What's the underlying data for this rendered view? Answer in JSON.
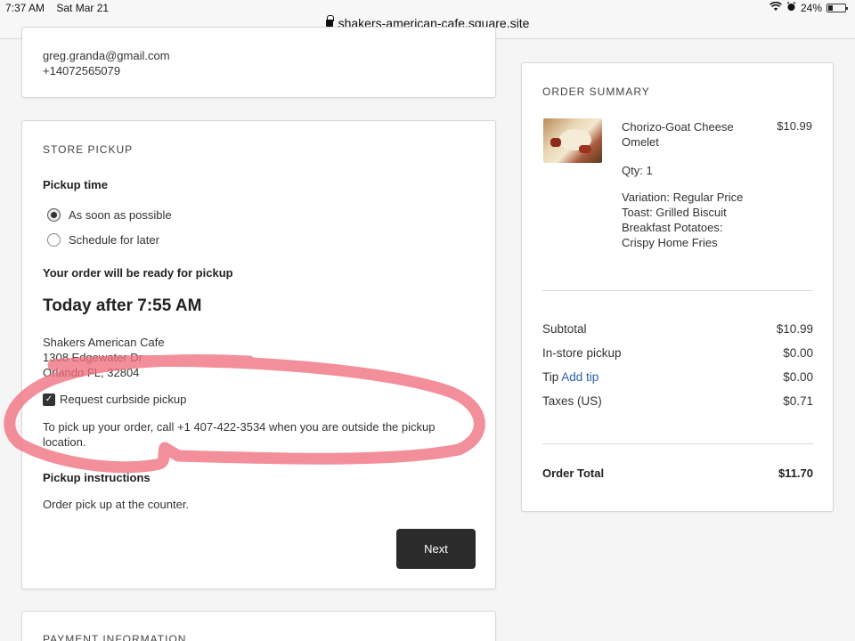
{
  "status": {
    "time": "7:37 AM",
    "date": "Sat Mar 21",
    "battery": "24%",
    "battery_level": 0.24
  },
  "browser": {
    "url": "shakers-american-cafe.square.site"
  },
  "contact": {
    "email": "greg.granda@gmail.com",
    "phone": "+14072565079"
  },
  "pickup": {
    "section_title": "STORE PICKUP",
    "pickup_time_label": "Pickup time",
    "options": [
      {
        "label": "As soon as possible",
        "selected": true
      },
      {
        "label": "Schedule for later",
        "selected": false
      }
    ],
    "ready_label": "Your order will be ready for pickup",
    "ready_time": "Today after 7:55 AM",
    "store_name": "Shakers American Cafe",
    "store_street": "1308 Edgewater Dr",
    "store_city": "Orlando FL, 32804",
    "curbside_label": "Request curbside pickup",
    "curbside_checked": true,
    "curbside_text": "To pick up your order, call +1 407-422-3534 when you are outside the pickup location.",
    "instructions_label": "Pickup instructions",
    "instructions_text": "Order pick up at the counter.",
    "next_label": "Next"
  },
  "payment": {
    "section_title": "PAYMENT INFORMATION"
  },
  "summary": {
    "title": "ORDER SUMMARY",
    "item": {
      "name": "Chorizo-Goat Cheese Omelet",
      "price": "$10.99",
      "qty": "Qty: 1",
      "variation": "Variation: Regular Price",
      "toast": "Toast: Grilled Biscuit",
      "potatoes_label": "Breakfast Potatoes:",
      "potatoes_value": "Crispy Home Fries"
    },
    "rows": {
      "subtotal_label": "Subtotal",
      "subtotal_value": "$10.99",
      "pickup_label": "In-store pickup",
      "pickup_value": "$0.00",
      "tip_label": "Tip",
      "tip_link": "Add tip",
      "tip_value": "$0.00",
      "taxes_label": "Taxes (US)",
      "taxes_value": "$0.71"
    },
    "total_label": "Order Total",
    "total_value": "$11.70"
  },
  "colors": {
    "annotation": "#f0707e",
    "link": "#2a5db0",
    "button": "#2b2b2b"
  }
}
